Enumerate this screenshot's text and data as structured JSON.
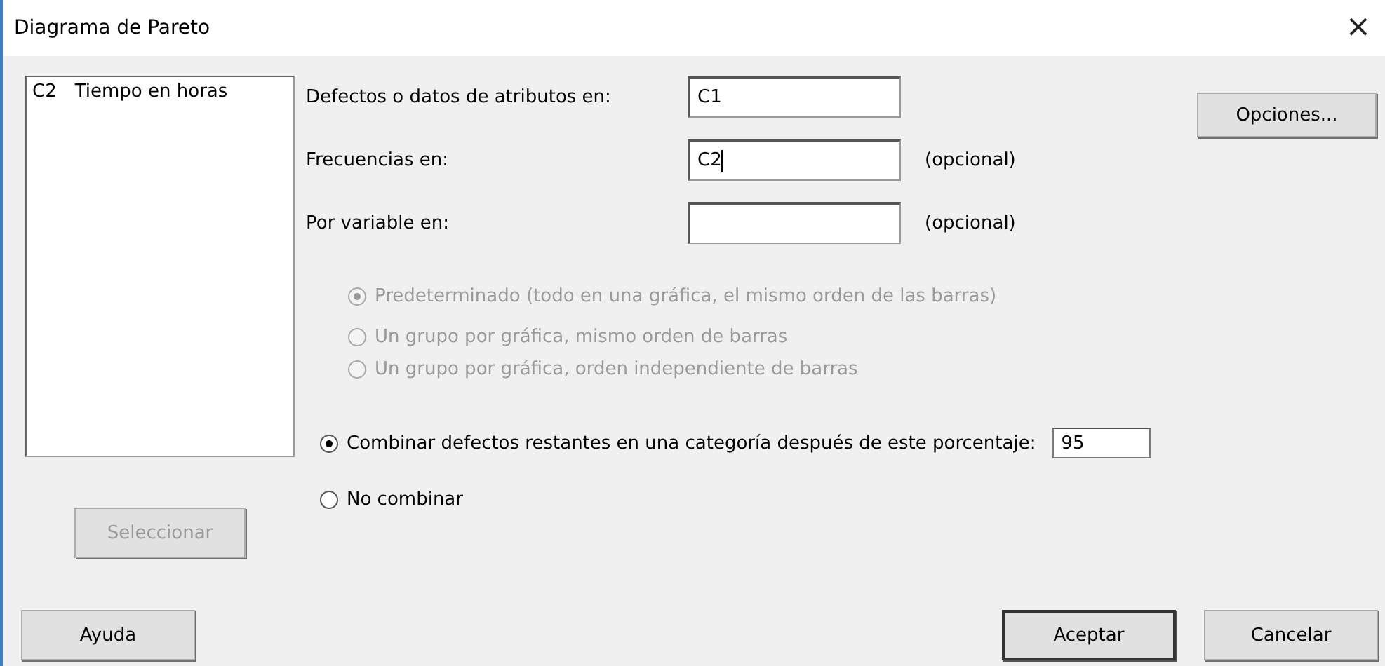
{
  "window": {
    "title": "Diagrama de Pareto",
    "close": "×"
  },
  "variables": [
    {
      "column": "C2",
      "name": "Tiempo en horas",
      "selected": false
    }
  ],
  "select_button": {
    "label": "Seleccionar",
    "disabled": true
  },
  "fields": [
    {
      "label": "Defectos o datos de atributos en:",
      "value": "C1",
      "focused": false
    },
    {
      "label": "Frecuencias en:",
      "value": "C2",
      "focused": true,
      "note": "(opcional)"
    },
    {
      "label": "Por variable en:",
      "focused": false,
      "note": "(opcional)"
    }
  ],
  "options_button": "Opciones...",
  "by_variable_options": [
    {
      "label": "Predeterminado (todo en una gráfica, el mismo orden de las barras)",
      "selected": true,
      "disabled": true
    },
    {
      "label": "Un grupo por gráfica, mismo orden de barras",
      "selected": false,
      "disabled": true
    },
    {
      "label": "Un grupo por gráfica, orden independiente de barras",
      "selected": false,
      "disabled": true
    }
  ],
  "combine_options": [
    {
      "kind": "with_field",
      "label": "Combinar defectos restantes en una categoría después de este porcentaje:",
      "value": "95",
      "selected": true,
      "disabled": false
    },
    {
      "kind": "plain",
      "label": "No combinar",
      "selected": false,
      "disabled": false
    }
  ],
  "buttons": [
    {
      "label": "Ayuda",
      "default": false
    },
    {
      "label": "Aceptar",
      "default": true
    },
    {
      "label": "Cancelar",
      "default": false
    }
  ]
}
